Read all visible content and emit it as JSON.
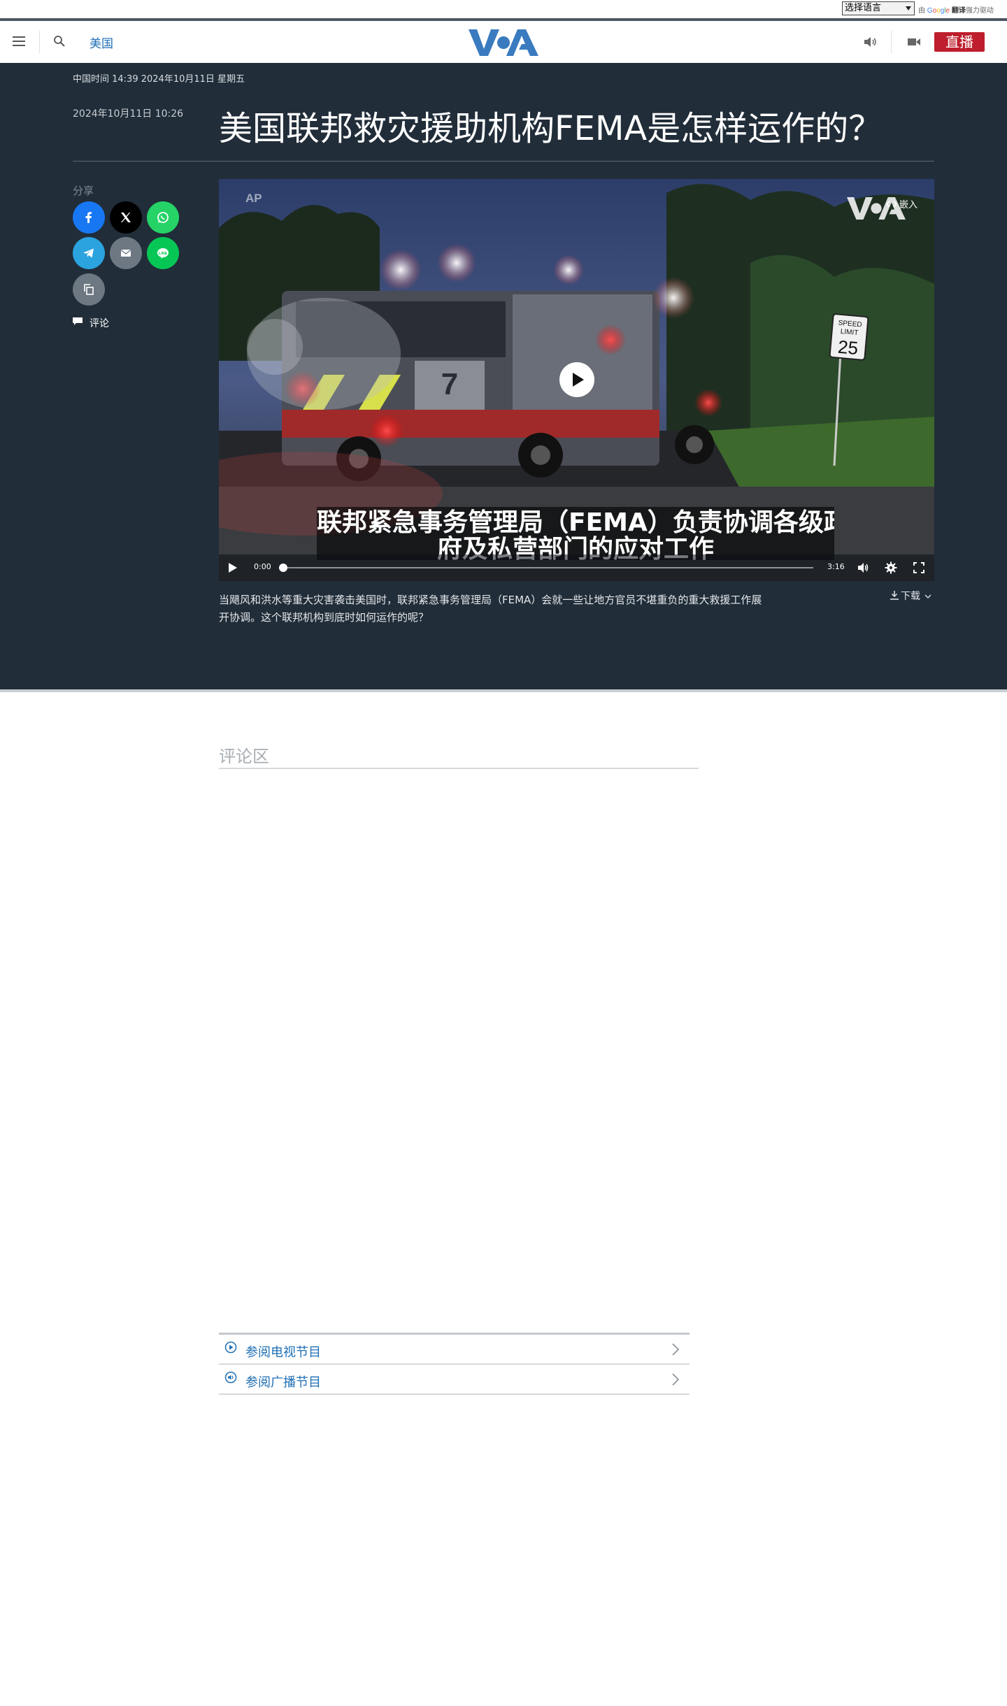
{
  "translate": {
    "select_label": "选择语言",
    "powered_prefix": "由",
    "powered_google": "Google",
    "powered_translate": "翻译",
    "powered_suffix": "强力驱动"
  },
  "header": {
    "section": "美国",
    "logo_text": "VOA",
    "live_label": "直播"
  },
  "article": {
    "local_time": "中国时间 14:39 2024年10月11日 星期五",
    "publish_date": "2024年10月11日 10:26",
    "title": "美国联邦救灾援助机构FEMA是怎样运作的？",
    "share_label": "分享",
    "comments_label": "评论",
    "caption": "当飓风和洪水等重大灾害袭击美国时，联邦紧急事务管理局（FEMA）会就一些让地方官员不堪重负的重大救援工作展开协调。这个联邦机构到底时如何运作的呢？",
    "download_label": "下载"
  },
  "video": {
    "ap_mark": "AP",
    "embed_label": "嵌入",
    "subtitle_line1": "联邦紧急事务管理局（FEMA）负责协调各级政",
    "subtitle_line2": "府及私营部门的应对工作",
    "current_time": "0:00",
    "duration": "3:16",
    "progress": 0.0,
    "sign_line1": "SPEED",
    "sign_line2": "LIMIT",
    "sign_number": "25",
    "truck_number": "7"
  },
  "share_buttons": [
    {
      "name": "facebook",
      "color": "#1877f2"
    },
    {
      "name": "x",
      "color": "#000000"
    },
    {
      "name": "whatsapp",
      "color": "#25d366"
    },
    {
      "name": "telegram",
      "color": "#2aa3df"
    },
    {
      "name": "email",
      "color": "#6d7882"
    },
    {
      "name": "line",
      "color": "#06c755"
    },
    {
      "name": "copy-link",
      "color": "#6d7882"
    }
  ],
  "comments": {
    "title": "评论区"
  },
  "programs": [
    {
      "label": "参阅电视节目",
      "icon": "play-circle-icon"
    },
    {
      "label": "参阅广播节目",
      "icon": "speaker-circle-icon"
    }
  ],
  "colors": {
    "dark_bg": "#212d39",
    "link_blue": "#1f6fb5",
    "live_red": "#be1e2d",
    "voa_blue": "#3a7bbf"
  }
}
